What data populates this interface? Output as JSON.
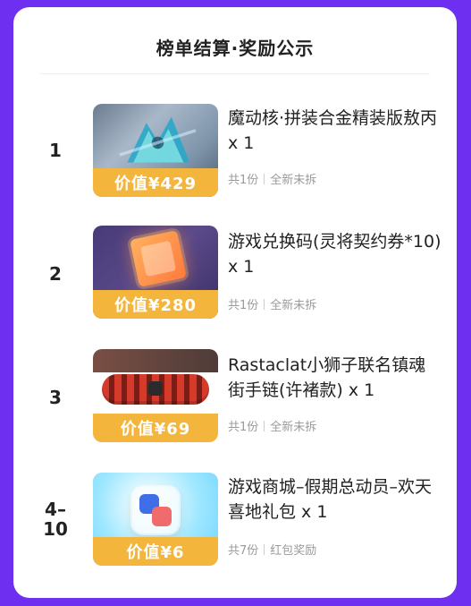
{
  "header": {
    "title": "榜单结算·奖励公示"
  },
  "rows": [
    {
      "rank": "1",
      "name": "魔动核·拼装合金精装版敖丙 x 1",
      "price": "价值¥429",
      "meta_count": "共1份",
      "meta_tag": "全新未拆"
    },
    {
      "rank": "2",
      "name": "游戏兑换码(灵将契约券*10) x 1",
      "price": "价值¥280",
      "meta_count": "共1份",
      "meta_tag": "全新未拆"
    },
    {
      "rank": "3",
      "name": "Rastaclat小狮子联名镇魂街手链(许褚款) x 1",
      "price": "价值¥69",
      "meta_count": "共1份",
      "meta_tag": "全新未拆"
    },
    {
      "rank": "4–\n10",
      "name": "游戏商城–假期总动员–欢天喜地礼包 x 1",
      "price": "价值¥6",
      "meta_count": "共7份",
      "meta_tag": "红包奖励"
    }
  ],
  "colors": {
    "background": "#6f2ff0",
    "card": "#ffffff",
    "price_strip": "#f3b53b",
    "meta_gray": "#9a9a9a"
  },
  "icons": {
    "thumb1": "figure-thumbnail",
    "thumb2": "redeem-code-thumbnail",
    "thumb3": "bracelet-thumbnail",
    "thumb4": "game-pack-thumbnail"
  }
}
